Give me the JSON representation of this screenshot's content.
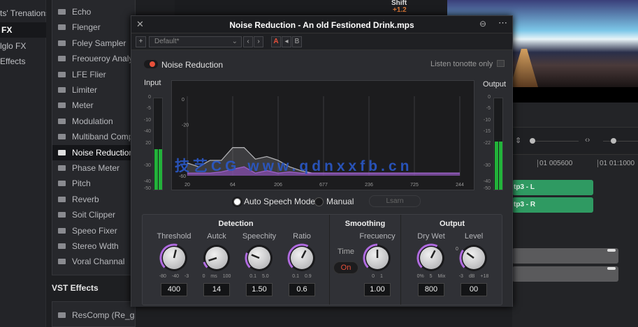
{
  "categories": [
    "ts' Trenations",
    "FX",
    "lglo FX",
    "Effects"
  ],
  "effects": [
    "Echo",
    "Flenger",
    "Foley Sampler",
    "Freoueroy Analyce",
    "LFE Flier",
    "Limiter",
    "Meter",
    "Modulation",
    "Multiband Compre",
    "Noise Reduction",
    "Phase Meter",
    "Pitch",
    "Reverb",
    "Soit Clipper",
    "Speeo Fixer",
    "Stereo Wdth",
    "Voral Channal"
  ],
  "selected_effect": "Noise Reduction",
  "vst": {
    "heading": "VST Effects",
    "items": [
      "ResComp (Re_gs E...."
    ]
  },
  "top_strip": {
    "shift_label": "Shift",
    "shift_value": "+1.2"
  },
  "timeline": {
    "timecodes": [
      "01 005600",
      "01 01:1000"
    ],
    "clips": [
      "tp3 - L",
      "tp3 - R"
    ]
  },
  "dialog": {
    "title": "Noise Reduction - An old Festioned Drink.mps",
    "preset": "Default*",
    "toolbar_buttons": [
      "A",
      "◂",
      "B"
    ],
    "enable_label": "Noise Reduction",
    "enabled": true,
    "listen_label": "Listen tonotte only",
    "input_label": "Input",
    "output_label": "Output",
    "input_ticks": [
      "0",
      "-5",
      "-10",
      "-40",
      "20",
      "-30",
      "-40",
      "-50"
    ],
    "output_ticks": [
      "0",
      "-5",
      "-10",
      "-15",
      "-22",
      "-30",
      "-40",
      "-50"
    ],
    "input_level": 0.44,
    "output_level": 0.53,
    "graph": {
      "x_ticks": [
        "20",
        "64",
        "206",
        "677",
        "236",
        "725",
        "244"
      ],
      "y_ticks": [
        "0",
        "-20",
        "-60"
      ],
      "input_curve": [
        -50,
        -53,
        -48,
        -48,
        -38,
        -38,
        -47,
        -45,
        -48,
        -53,
        -56,
        -58,
        -58,
        -58,
        -58,
        -58,
        -58,
        -58,
        -58,
        -58,
        -58,
        -58,
        -58,
        -58,
        -58
      ],
      "noise_curve": [
        -58,
        -58,
        -58,
        -57,
        -55,
        -53,
        -58,
        -56,
        -58,
        -57,
        -58,
        -58,
        -58,
        -58,
        -58,
        -58,
        -58,
        -58,
        -58,
        -58,
        -58,
        -58,
        -58,
        -58,
        -58
      ]
    },
    "modes": {
      "auto": "Auto Speech Mode",
      "manual": "Manual",
      "learn": "Lsarn",
      "selected": "auto"
    },
    "sections": {
      "detection": {
        "title": "Detection",
        "knobs": [
          {
            "name": "Threshold",
            "scale": "-80 -40 -3",
            "value": "400",
            "level": 0.55
          },
          {
            "name": "Autck",
            "scale": "0 ms 100",
            "value": "14",
            "level": 0.1
          },
          {
            "name": "Speechity",
            "scale": "0.1 5.0",
            "value": "1.50",
            "level": 0.25
          },
          {
            "name": "Ratio",
            "scale": "0.1 0.9",
            "value": "0.6",
            "level": 0.6
          }
        ]
      },
      "smoothing": {
        "title": "Smoothing",
        "time_label": "Time",
        "time_toggle": "On",
        "knobs": [
          {
            "name": "Frecuency",
            "scale": "0 1",
            "value": "1.00",
            "level": 0.5
          }
        ]
      },
      "output": {
        "title": "Output",
        "knobs": [
          {
            "name": "Dry Wet",
            "scale": "0% 5 Mix",
            "value": "800",
            "level": 0.6
          },
          {
            "name": "Level",
            "scale": "-3 dB +18",
            "value": "00",
            "level": 0.3,
            "zero_mark": "0"
          }
        ]
      }
    }
  },
  "watermark": "技艺CG www.qdnxxfb.cn",
  "colors": {
    "accent": "#b06be0",
    "meter": "#22b33a",
    "enable": "#e8503a",
    "clip": "#2f9a62"
  }
}
